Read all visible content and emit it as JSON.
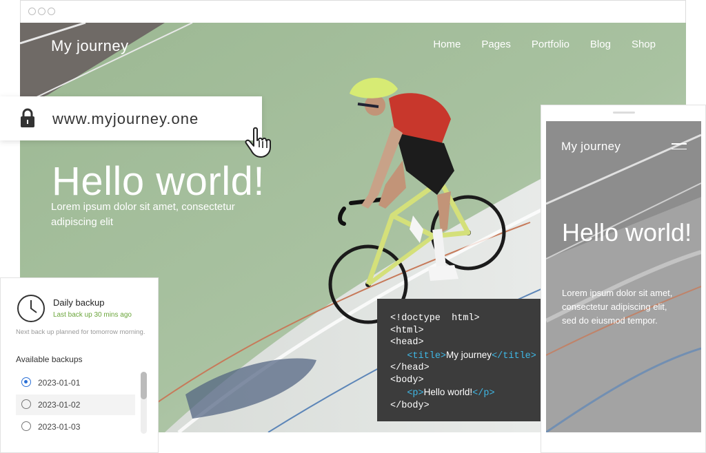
{
  "site": {
    "logo": "My journey",
    "nav": [
      "Home",
      "Pages",
      "Portfolio",
      "Blog",
      "Shop"
    ],
    "hero_title": "Hello world!",
    "hero_subtitle": "Lorem ipsum dolor sit amet, consectetur adipiscing elit"
  },
  "urlbar": {
    "url": "www.myjourney.one"
  },
  "backup": {
    "title": "Daily backup",
    "last_backup": "Last back up 30 mins ago",
    "note": "Next back up planned for tomorrow morning.",
    "available_label": "Available backups",
    "items": [
      {
        "label": "2023-01-01",
        "selected": true
      },
      {
        "label": "2023-01-02",
        "selected": false
      },
      {
        "label": "2023-01-03",
        "selected": false
      }
    ]
  },
  "code": {
    "doctype": "<!doctype  html>",
    "html_open": "<html>",
    "head_open": "<head>",
    "title_open": "<title>",
    "title_text": "My journey",
    "title_close": "</title>",
    "head_close": "</head>",
    "body_open": "<body>",
    "p_open": "<p>",
    "p_text": "Hello world!",
    "p_close": "</p>",
    "body_close": "</body>"
  },
  "mobile": {
    "logo": "My journey",
    "title": "Hello world!",
    "subtitle": "Lorem ipsum dolor sit amet, consectetur adipiscing elit, sed do eiusmod tempor."
  },
  "colors": {
    "accent_link": "#3fb8e6",
    "success": "#6aa53a",
    "radio_selected": "#2a6fd6",
    "code_bg": "#3c3c3c"
  },
  "icons": [
    "lock-icon",
    "pointer-hand-icon",
    "clock-icon",
    "hamburger-menu-icon",
    "radio-icon"
  ]
}
